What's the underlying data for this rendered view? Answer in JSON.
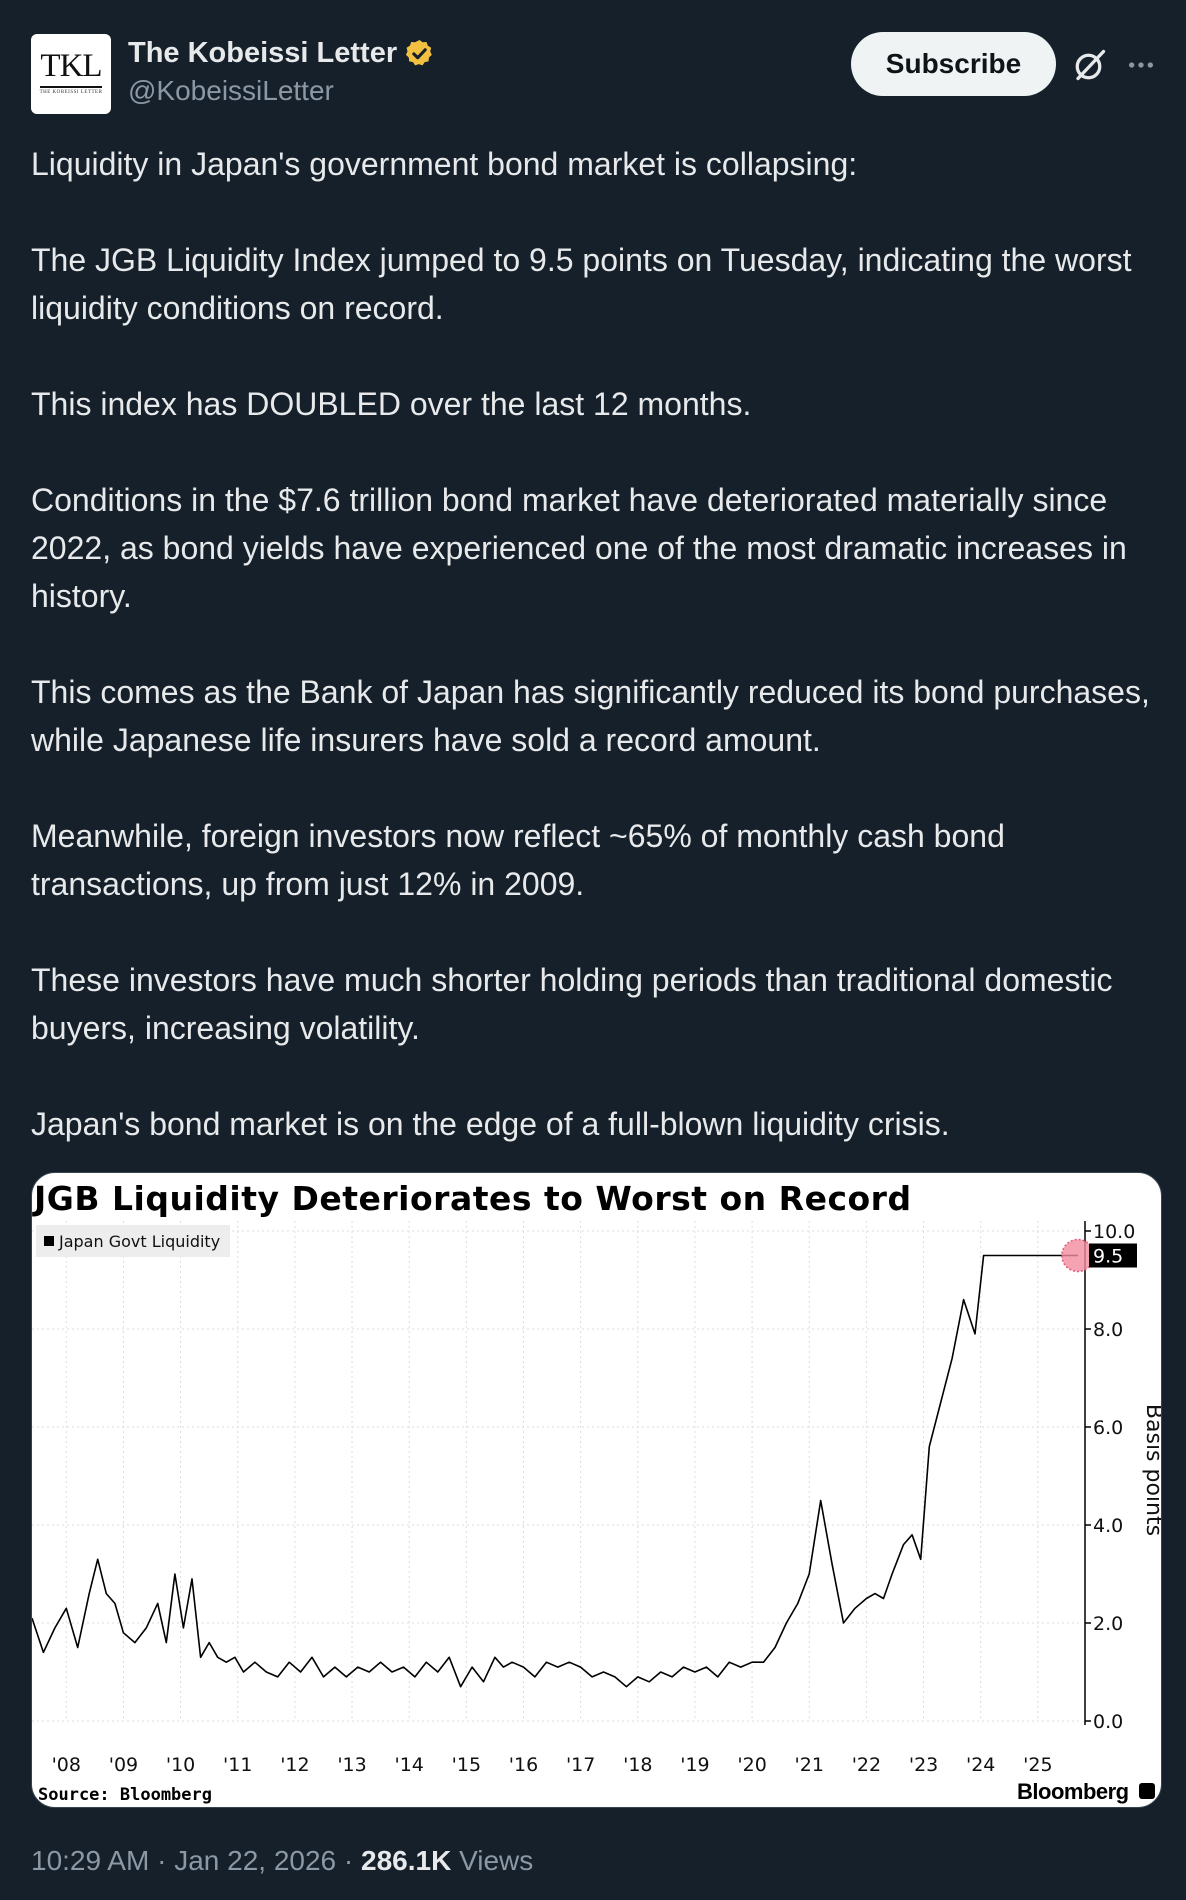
{
  "author": {
    "display_name": "The Kobeissi Letter",
    "handle": "@KobeissiLetter",
    "avatar_text": "TKL",
    "avatar_subtext": "THE KOBEISSI LETTER",
    "verified_color": "#f4c042"
  },
  "actions": {
    "subscribe_label": "Subscribe",
    "grok_icon": "grok-icon",
    "more_icon": "more-icon"
  },
  "tweet": {
    "paragraphs": [
      "Liquidity in Japan's government bond market is collapsing:",
      "The JGB Liquidity Index jumped to 9.5 points on Tuesday, indicating the worst liquidity conditions on record.",
      "This index has DOUBLED over the last 12 months.",
      "Conditions in the $7.6 trillion bond market have deteriorated materially since 2022, as bond yields have experienced one of the most dramatic increases in history.",
      "This comes as the Bank of Japan has significantly reduced its bond purchases, while Japanese life insurers have sold a record amount.",
      "Meanwhile, foreign investors now reflect ~65% of monthly cash bond transactions, up from just 12% in 2009.",
      "These investors have much shorter holding periods than traditional domestic buyers, increasing volatility.",
      "Japan's bond market is on the edge of a full-blown liquidity crisis."
    ]
  },
  "chart_data": {
    "type": "line",
    "title": "JGB Liquidity Deteriorates to Worst on Record",
    "source": "Source: Bloomberg",
    "brand": "Bloomberg",
    "ylabel": "Basis points",
    "ylim": [
      0,
      10.0
    ],
    "y_ticks": [
      "0.0",
      "2.0",
      "4.0",
      "6.0",
      "8.0",
      "10.0"
    ],
    "x_ticks": [
      "'08",
      "'09",
      "'10",
      "'11",
      "'12",
      "'13",
      "'14",
      "'15",
      "'16",
      "'17",
      "'18",
      "'19",
      "'20",
      "'21",
      "'22",
      "'23",
      "'24",
      "'25"
    ],
    "grid": true,
    "last_value_label": "9.5",
    "highlight_color": "#f38ba0",
    "series": [
      {
        "name": "Japan Govt Liquidity",
        "x": [
          2007.4,
          2007.6,
          2007.8,
          2008.0,
          2008.2,
          2008.4,
          2008.55,
          2008.7,
          2008.85,
          2009.0,
          2009.2,
          2009.4,
          2009.6,
          2009.75,
          2009.9,
          2010.05,
          2010.2,
          2010.35,
          2010.5,
          2010.65,
          2010.8,
          2010.95,
          2011.1,
          2011.3,
          2011.5,
          2011.7,
          2011.9,
          2012.1,
          2012.3,
          2012.5,
          2012.7,
          2012.9,
          2013.1,
          2013.3,
          2013.5,
          2013.7,
          2013.9,
          2014.1,
          2014.3,
          2014.5,
          2014.7,
          2014.9,
          2015.1,
          2015.3,
          2015.5,
          2015.65,
          2015.8,
          2016.0,
          2016.2,
          2016.4,
          2016.6,
          2016.8,
          2017.0,
          2017.2,
          2017.4,
          2017.6,
          2017.8,
          2018.0,
          2018.2,
          2018.4,
          2018.6,
          2018.8,
          2019.0,
          2019.2,
          2019.4,
          2019.6,
          2019.8,
          2020.0,
          2020.2,
          2020.4,
          2020.6,
          2020.8,
          2021.0,
          2021.2,
          2021.4,
          2021.6,
          2021.8,
          2022.0,
          2022.15,
          2022.3,
          2022.45,
          2022.55,
          2022.65,
          2022.8,
          2022.95,
          2023.1,
          2023.3,
          2023.5,
          2023.7,
          2023.9,
          2024.05,
          2024.2,
          2024.35,
          2024.5,
          2024.65,
          2024.75,
          2024.85,
          2024.95,
          2025.0,
          2025.1,
          2025.25,
          2025.4,
          2025.5,
          2025.55,
          2025.6,
          2025.7
        ],
        "values": [
          2.1,
          1.4,
          1.9,
          2.3,
          1.5,
          2.6,
          3.3,
          2.6,
          2.4,
          1.8,
          1.6,
          1.9,
          2.4,
          1.6,
          3.0,
          1.9,
          2.9,
          1.3,
          1.6,
          1.3,
          1.2,
          1.3,
          1.0,
          1.2,
          1.0,
          0.9,
          1.2,
          1.0,
          1.3,
          0.9,
          1.1,
          0.9,
          1.1,
          1.0,
          1.2,
          1.0,
          1.1,
          0.9,
          1.2,
          1.0,
          1.3,
          0.7,
          1.1,
          0.8,
          1.3,
          1.1,
          1.2,
          1.1,
          0.9,
          1.2,
          1.1,
          1.2,
          1.1,
          0.9,
          1.0,
          0.9,
          0.7,
          0.9,
          0.8,
          1.0,
          0.9,
          1.1,
          1.0,
          1.1,
          0.9,
          1.2,
          1.1,
          1.2,
          1.2,
          1.5,
          2.0,
          2.4,
          3.0,
          4.5,
          3.2,
          2.0,
          2.3,
          2.5,
          2.6,
          2.5,
          3.0,
          3.3,
          3.6,
          3.8,
          3.3,
          5.6,
          6.5,
          7.4,
          8.6,
          7.9,
          9.5,
          9.5,
          9.5,
          9.5,
          9.5,
          9.5,
          9.5,
          9.5,
          9.5,
          9.5,
          9.5,
          9.5,
          9.5,
          9.5,
          9.5,
          9.5
        ]
      }
    ]
  },
  "meta": {
    "time": "10:29 AM",
    "separator": "·",
    "date": "Jan 22, 2026",
    "views_count": "286.1K",
    "views_label": "Views"
  }
}
